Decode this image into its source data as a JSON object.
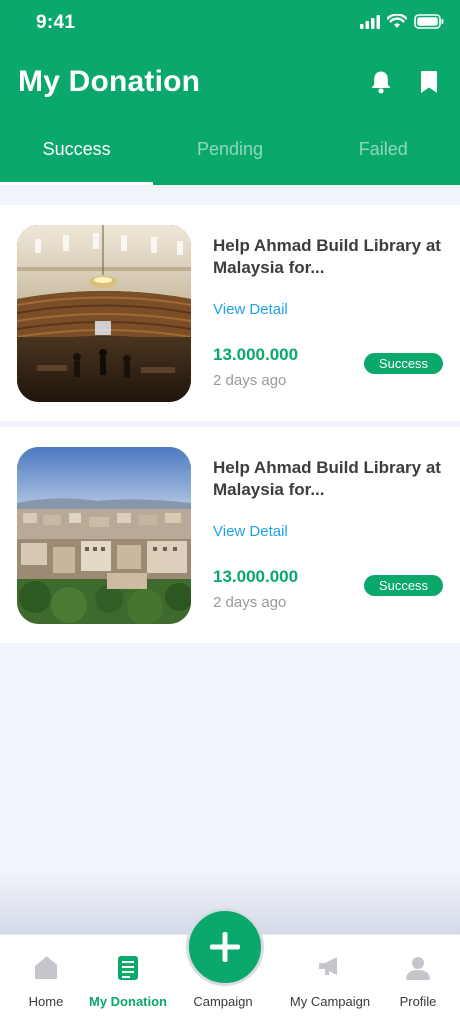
{
  "status_bar": {
    "time": "9:41"
  },
  "header": {
    "title": "My Donation",
    "tabs": [
      {
        "label": "Success",
        "active": true
      },
      {
        "label": "Pending",
        "active": false
      },
      {
        "label": "Failed",
        "active": false
      }
    ]
  },
  "donations": [
    {
      "title": "Help Ahmad Build Library at Malaysia for...",
      "link": "View Detail",
      "amount": "13.000.000",
      "time_ago": "2 days ago",
      "status": "Success",
      "image": "library-interior-photo"
    },
    {
      "title": "Help Ahmad Build Library at Malaysia for...",
      "link": "View Detail",
      "amount": "13.000.000",
      "time_ago": "2 days ago",
      "status": "Success",
      "image": "city-aerial-photo"
    }
  ],
  "tabbar": {
    "items": [
      {
        "label": "Home",
        "icon": "home-icon",
        "active": false
      },
      {
        "label": "My Donation",
        "icon": "document-icon",
        "active": true
      },
      {
        "label": "Campaign",
        "icon": "plus-icon",
        "active": false
      },
      {
        "label": "My Campaign",
        "icon": "megaphone-icon",
        "active": false
      },
      {
        "label": "Profile",
        "icon": "person-icon",
        "active": false
      }
    ]
  },
  "colors": {
    "brand": "#0aa86b",
    "link": "#1fa3e6",
    "background": "#f1f4fb"
  }
}
